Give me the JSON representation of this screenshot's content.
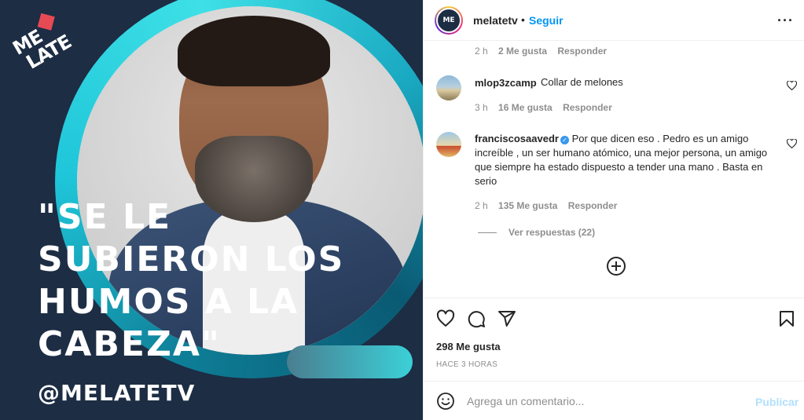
{
  "post": {
    "brand_logo_text": [
      "ME",
      "LATE"
    ],
    "quote_lines": [
      "\"SE LE",
      "SUBIERON LOS",
      "HUMOS A LA",
      "CABEZA\""
    ],
    "handle": "@MELATETV"
  },
  "header": {
    "username": "melatetv",
    "separator": "•",
    "follow_label": "Seguir",
    "more_icon": "···"
  },
  "comments": [
    {
      "time": "2 h",
      "likes": "2 Me gusta",
      "reply": "Responder"
    },
    {
      "username": "mlop3zcamp",
      "text": "Collar de melones",
      "time": "3 h",
      "likes": "16 Me gusta",
      "reply": "Responder"
    },
    {
      "username": "franciscosaavedr",
      "verified": true,
      "text": "Por que dicen eso . Pedro es un amigo increíble , un ser humano atómico, una mejor persona, un amigo que siempre ha estado dispuesto a tender una mano . Basta en serio",
      "time": "2 h",
      "likes": "135 Me gusta",
      "reply": "Responder",
      "view_replies": "Ver respuestas (22)"
    }
  ],
  "actions": {
    "likes_count": "298 Me gusta",
    "time_ago": "HACE 3 HORAS"
  },
  "add_comment": {
    "placeholder": "Agrega un comentario...",
    "publish_label": "Publicar"
  },
  "colors": {
    "accent_blue": "#0095f6",
    "publish_disabled": "#b2dffc",
    "post_bg": "#1d2d44",
    "ring_teal": "#1fc6d9"
  }
}
